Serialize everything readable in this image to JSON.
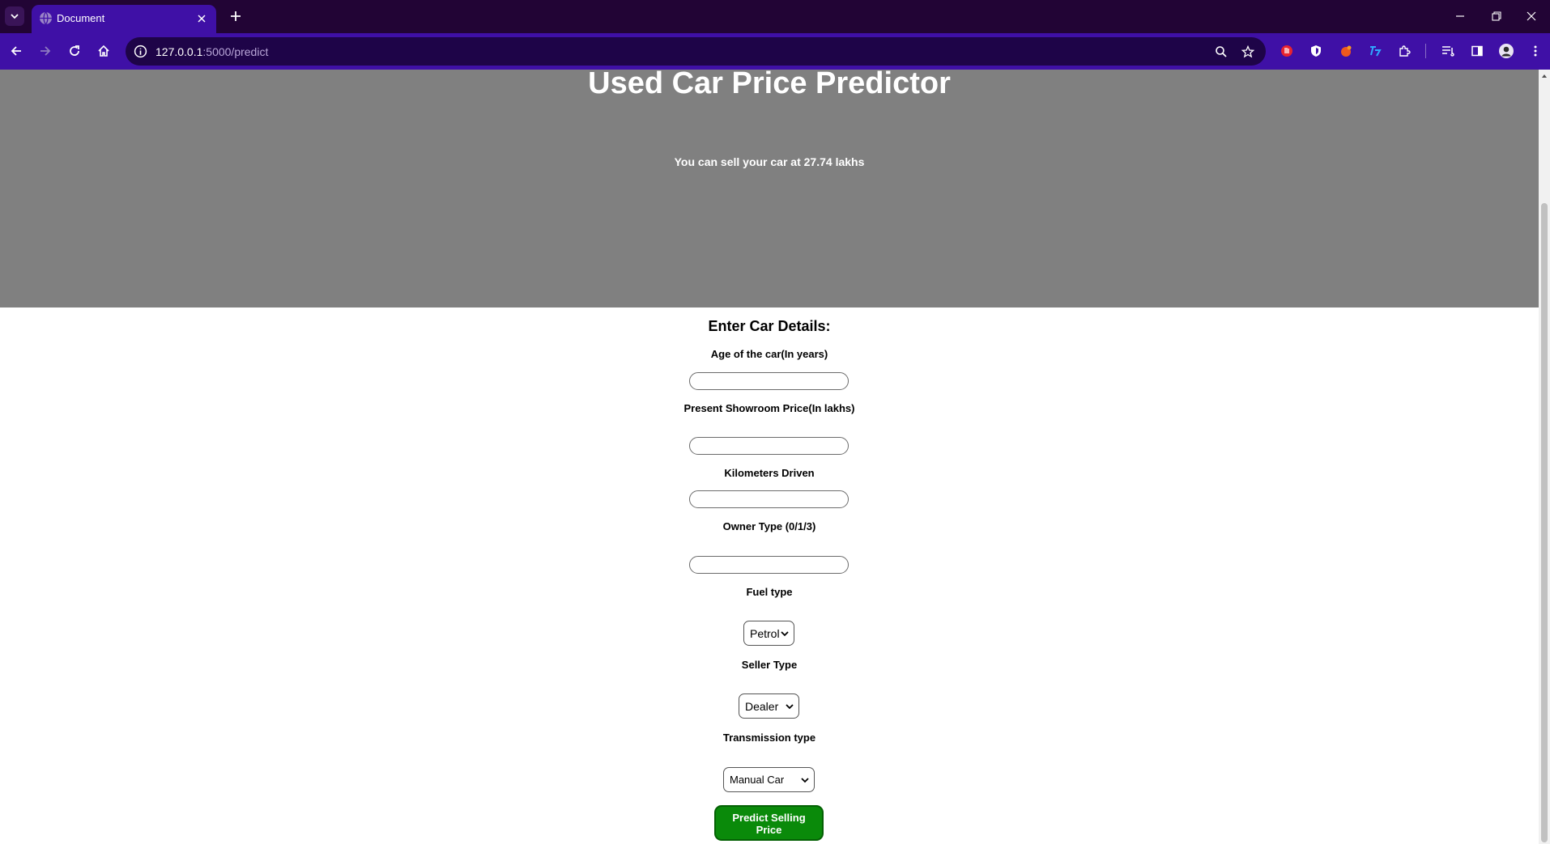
{
  "browser": {
    "tab_title": "Document",
    "url_host": "127.0.0.1",
    "url_path": ":5000/predict"
  },
  "page": {
    "title": "Used Car Price Predictor",
    "result_text": "You can sell your car at 27.74 lakhs",
    "form_heading": "Enter Car Details:",
    "labels": {
      "age": "Age of the car(In years)",
      "price": "Present Showroom Price(In lakhs)",
      "kms": "Kilometers Driven",
      "owner": "Owner Type (0/1/3)",
      "fuel": "Fuel type",
      "seller": "Seller Type",
      "transmission": "Transmission type"
    },
    "inputs": {
      "age_value": "",
      "price_value": "",
      "kms_value": "",
      "owner_value": ""
    },
    "selects": {
      "fuel": "Petrol",
      "seller": "Dealer",
      "transmission": "Manual Car"
    },
    "submit_label_line1": "Predict Selling",
    "submit_label_line2": "Price"
  },
  "colors": {
    "hero_bg": "#808080",
    "submit_bg": "#0a8a0a",
    "browser_accent": "#3f10a6"
  }
}
